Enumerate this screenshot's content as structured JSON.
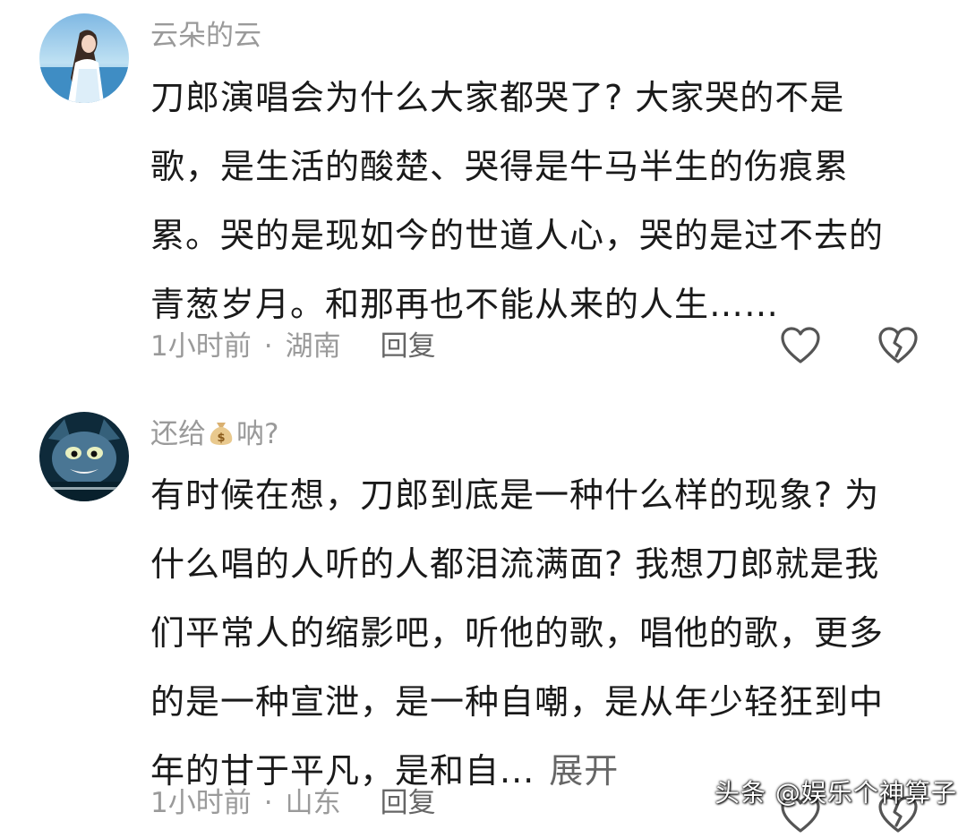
{
  "comments": [
    {
      "username": "云朵的云",
      "lines": [
        "刀郎演唱会为什么大家都哭了? 大家哭的不是",
        "歌，是生活的酸楚、哭得是牛马半生的伤痕累",
        "累。哭的是现如今的世道人心，哭的是过不去的",
        "青葱岁月。和那再也不能从来的人生……"
      ],
      "time": "1小时前",
      "separator": "·",
      "location": "湖南",
      "reply_label": "回复",
      "like_icon": "heart-outline-icon",
      "dislike_icon": "broken-heart-icon"
    },
    {
      "username_prefix": "还给",
      "username_emoji": "money-bag-icon",
      "username_suffix": "呐?",
      "lines": [
        "有时候在想，刀郎到底是一种什么样的现象? 为",
        "什么唱的人听的人都泪流满面? 我想刀郎就是我",
        "们平常人的缩影吧，听他的歌，唱他的歌，更多",
        "的是一种宣泄，是一种自嘲，是从年少轻狂到中",
        "年的甘于平凡，是和自..."
      ],
      "expand_label": "展开",
      "time": "1小时前",
      "separator": "·",
      "location": "山东",
      "reply_label": "回复",
      "like_icon": "heart-outline-icon",
      "dislike_icon": "broken-heart-icon"
    }
  ],
  "watermark": "头条 @娱乐个神算子",
  "colors": {
    "text": "#1a1a1a",
    "secondary": "#9a9a9a",
    "reply": "#666666",
    "background": "#ffffff"
  }
}
